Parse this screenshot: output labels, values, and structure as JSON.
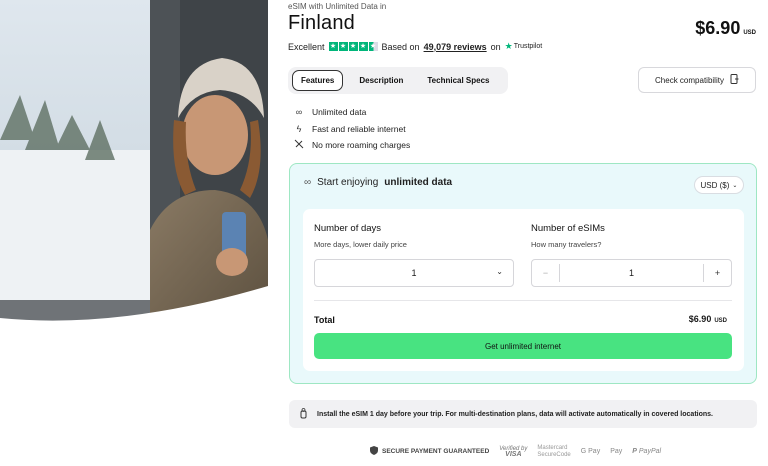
{
  "header": {
    "eyebrow": "eSIM with Unlimited Data in",
    "title": "Finland",
    "price": "$6.90",
    "price_currency": "USD"
  },
  "rating": {
    "label": "Excellent",
    "stars": 4.5,
    "based_on": "Based on",
    "reviews": "49,079 reviews",
    "on": "on",
    "source": "Trustpilot"
  },
  "tabs": [
    {
      "label": "Features",
      "active": true
    },
    {
      "label": "Description",
      "active": false
    },
    {
      "label": "Technical Specs",
      "active": false
    }
  ],
  "check_button": "Check compatibility",
  "features": [
    {
      "icon": "infinity-icon",
      "text": "Unlimited data"
    },
    {
      "icon": "lightning-icon",
      "text": "Fast and reliable internet"
    },
    {
      "icon": "no-roaming-icon",
      "text": "No more roaming charges"
    }
  ],
  "panel": {
    "prefix": "Start enjoying",
    "emphasis": "unlimited data",
    "currency": "USD ($)",
    "days_label": "Number of days",
    "days_sub": "More days, lower daily price",
    "days_value": "1",
    "esims_label": "Number of eSIMs",
    "esims_sub": "How many travelers?",
    "esims_value": "1",
    "minus": "−",
    "plus": "+",
    "total_label": "Total",
    "total_value": "$6.90",
    "total_currency": "USD",
    "cta": "Get unlimited internet"
  },
  "note": "Install the eSIM 1 day before your trip. For multi-destination plans, data will activate automatically in covered locations.",
  "payments": {
    "secure": "SECURE PAYMENT GUARANTEED",
    "verified_by": "Verified by",
    "visa": "VISA",
    "mastercard": "Mastercard",
    "securecode": "SecureCode",
    "gpay": "G Pay",
    "applepay": "Pay",
    "paypal": "PayPal"
  },
  "colors": {
    "accent": "#48e381",
    "panel_bg": "#e9f9fb",
    "panel_border": "#9ee7c3",
    "trustpilot": "#00b67a"
  }
}
